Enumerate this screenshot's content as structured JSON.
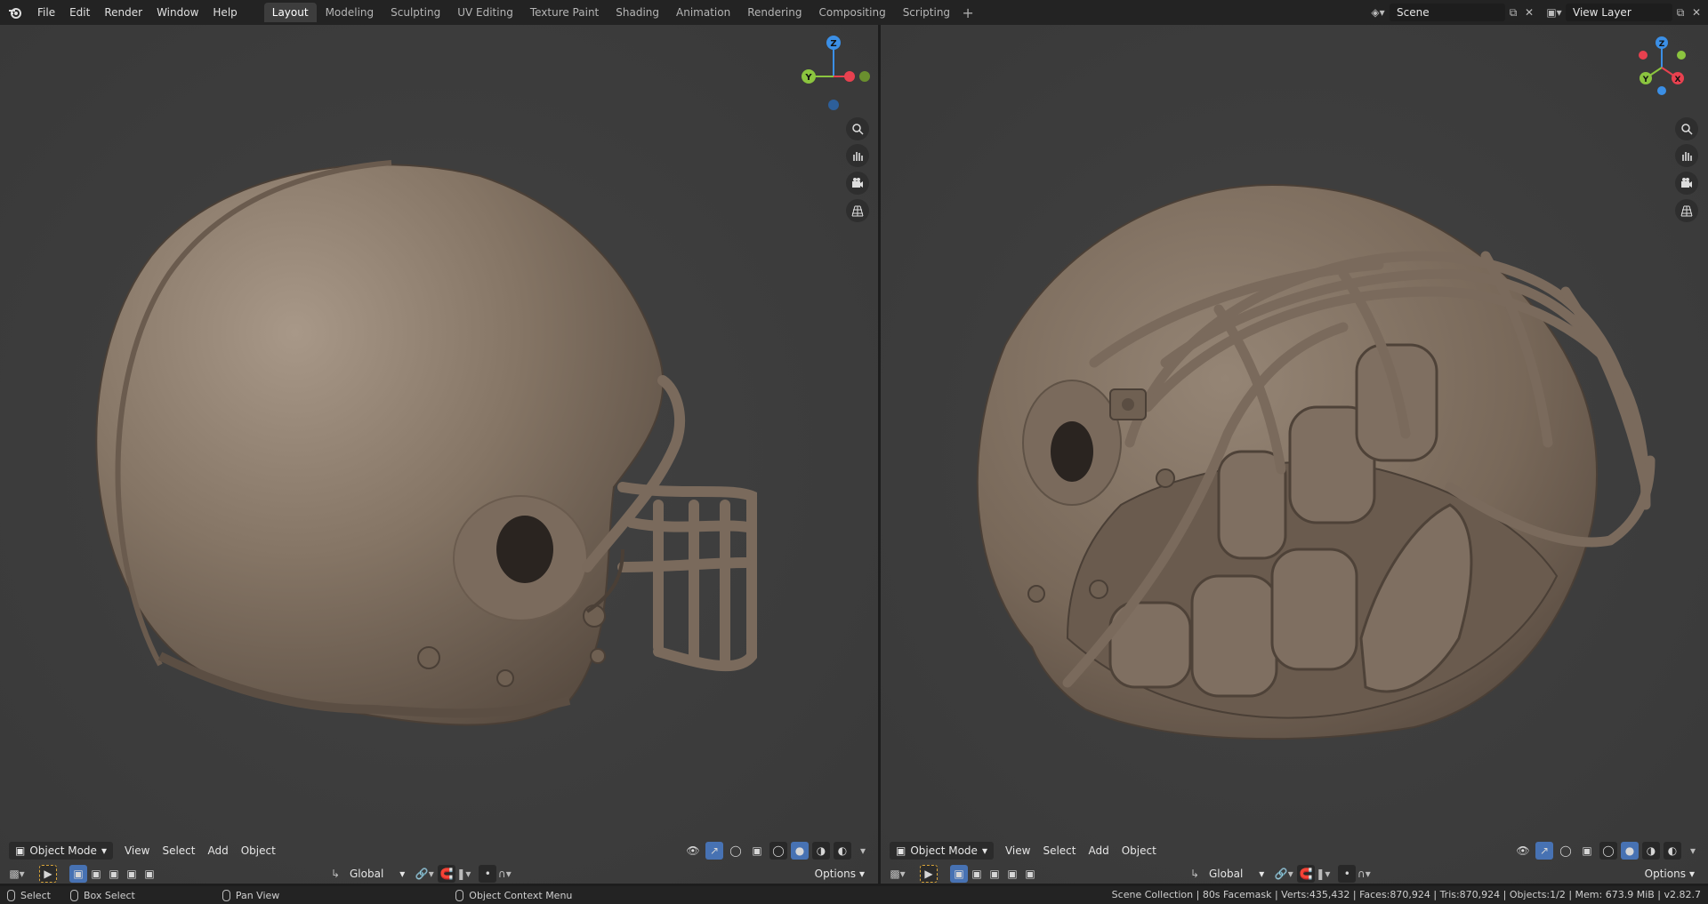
{
  "menu": [
    "File",
    "Edit",
    "Render",
    "Window",
    "Help"
  ],
  "workspaces": [
    "Layout",
    "Modeling",
    "Sculpting",
    "UV Editing",
    "Texture Paint",
    "Shading",
    "Animation",
    "Rendering",
    "Compositing",
    "Scripting"
  ],
  "active_workspace": "Layout",
  "scene": {
    "name": "Scene",
    "view_layer": "View Layer"
  },
  "viewport_left": {
    "mode": "Object Mode",
    "menus": [
      "View",
      "Select",
      "Add",
      "Object"
    ],
    "transform": "Global",
    "options": "Options",
    "gizmo": {
      "z": "Z",
      "y": "Y"
    }
  },
  "viewport_right": {
    "mode": "Object Mode",
    "menus": [
      "View",
      "Select",
      "Add",
      "Object"
    ],
    "transform": "Global",
    "options": "Options",
    "gizmo": {
      "z": "Z",
      "y": "Y",
      "x": "X"
    }
  },
  "status": {
    "select": "Select",
    "box_select": "Box Select",
    "pan_view": "Pan View",
    "context_menu": "Object Context Menu",
    "stats": "Scene Collection | 80s Facemask | Verts:435,432 | Faces:870,924 | Tris:870,924 | Objects:1/2 | Mem: 673.9 MiB | v2.82.7"
  },
  "colors": {
    "viewport_bg": "#3d3d3d",
    "helmet": "#8a7a6c",
    "axis_x": "#e8414f",
    "axis_y": "#8bc43f",
    "axis_z": "#3b8fe6",
    "selected": "#4772b3"
  }
}
